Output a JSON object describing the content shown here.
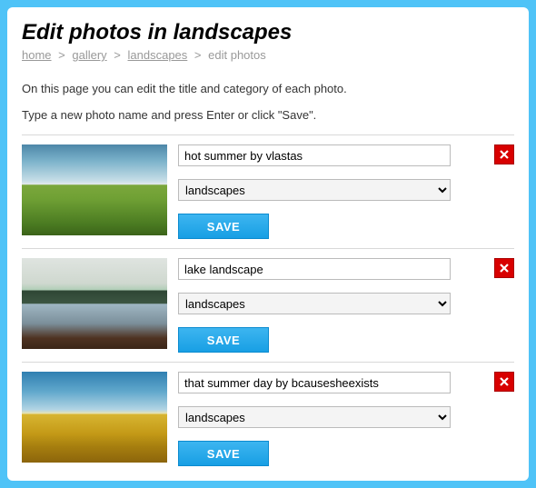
{
  "page": {
    "title": "Edit photos in landscapes"
  },
  "breadcrumb": {
    "items": [
      {
        "label": "home",
        "link": true
      },
      {
        "label": "gallery",
        "link": true
      },
      {
        "label": "landscapes",
        "link": true
      },
      {
        "label": "edit photos",
        "link": false
      }
    ],
    "separator": ">"
  },
  "intro": {
    "line1": "On this page you can edit the title and category of each photo.",
    "line2": "Type a new photo name and press Enter or click \"Save\"."
  },
  "categories": [
    "landscapes"
  ],
  "save_label": "SAVE",
  "photos": [
    {
      "title": "hot summer by vlastas",
      "category": "landscapes"
    },
    {
      "title": "lake landscape",
      "category": "landscapes"
    },
    {
      "title": "that summer day by bcausesheexists",
      "category": "landscapes"
    }
  ]
}
